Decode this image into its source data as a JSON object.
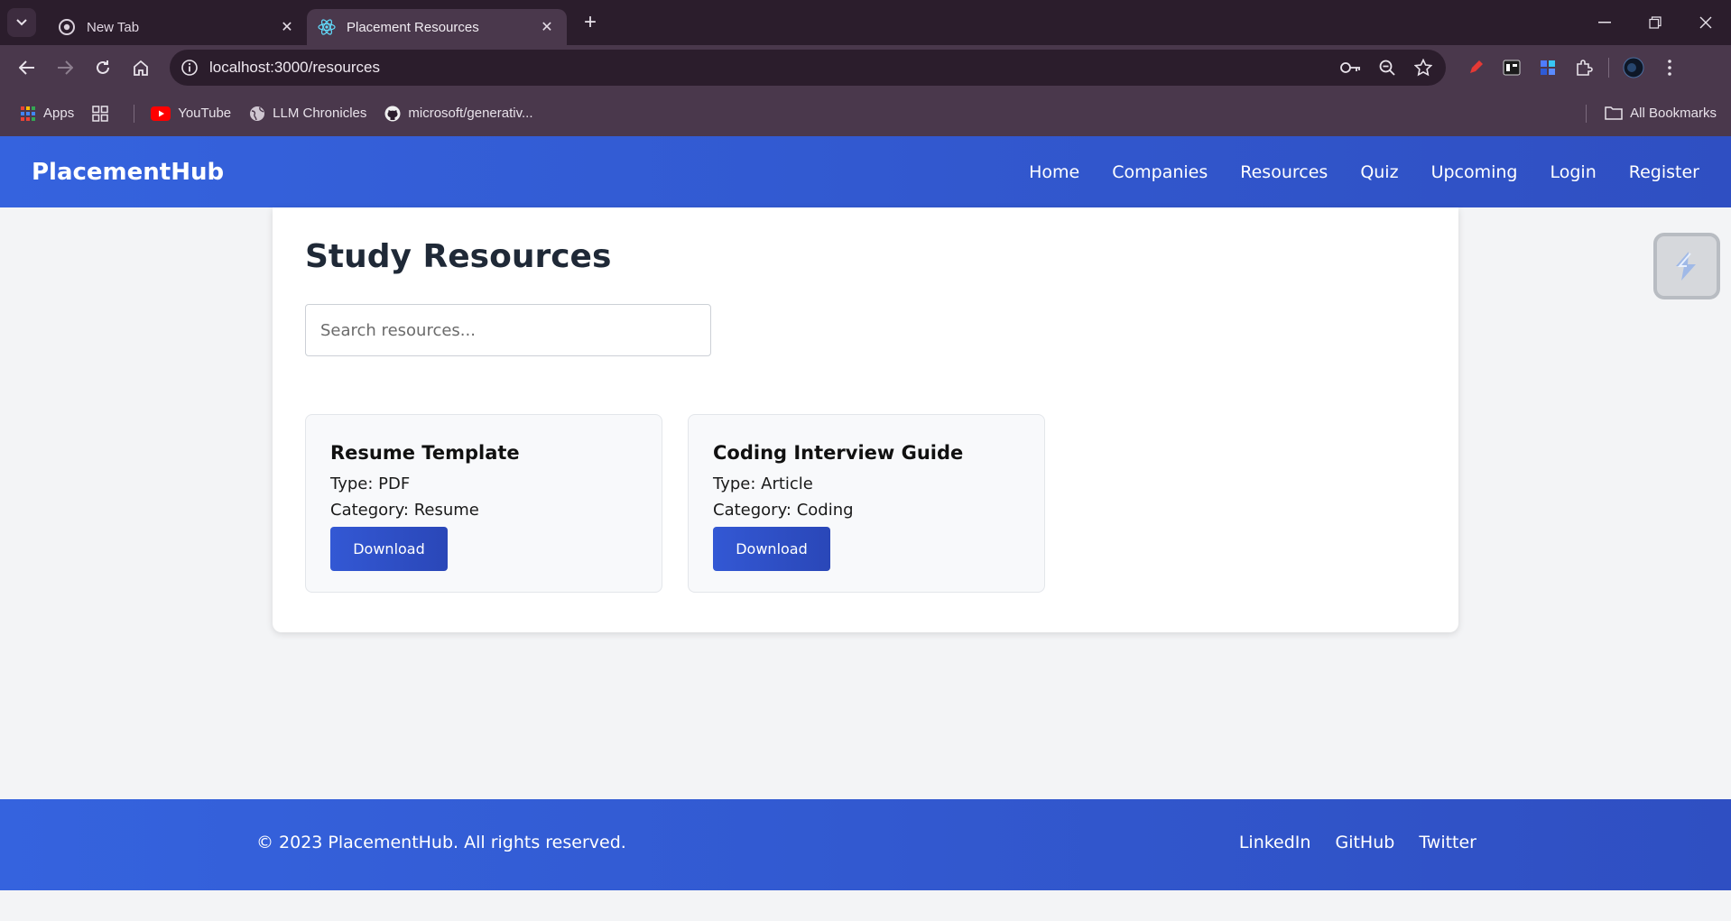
{
  "browser": {
    "tabs": [
      {
        "title": "New Tab",
        "icon": "chrome-icon",
        "active": false
      },
      {
        "title": "Placement Resources",
        "icon": "react-icon",
        "active": true
      }
    ],
    "url": "localhost:3000/resources",
    "bookmarks": [
      {
        "label": "Apps",
        "icon": "apps-grid-icon"
      },
      {
        "label": "YouTube",
        "icon": "youtube-icon"
      },
      {
        "label": "LLM Chronicles",
        "icon": "globe-icon"
      },
      {
        "label": "microsoft/generativ...",
        "icon": "github-icon"
      }
    ],
    "all_bookmarks": "All Bookmarks"
  },
  "header": {
    "logo": "PlacementHub",
    "nav": [
      "Home",
      "Companies",
      "Resources",
      "Quiz",
      "Upcoming",
      "Login",
      "Register"
    ]
  },
  "main": {
    "title": "Study Resources",
    "search_placeholder": "Search resources...",
    "resources": [
      {
        "title": "Resume Template",
        "type": "Type: PDF",
        "category": "Category: Resume",
        "button": "Download"
      },
      {
        "title": "Coding Interview Guide",
        "type": "Type: Article",
        "category": "Category: Coding",
        "button": "Download"
      }
    ]
  },
  "footer": {
    "copyright": "© 2023 PlacementHub. All rights reserved.",
    "links": [
      "LinkedIn",
      "GitHub",
      "Twitter"
    ]
  }
}
